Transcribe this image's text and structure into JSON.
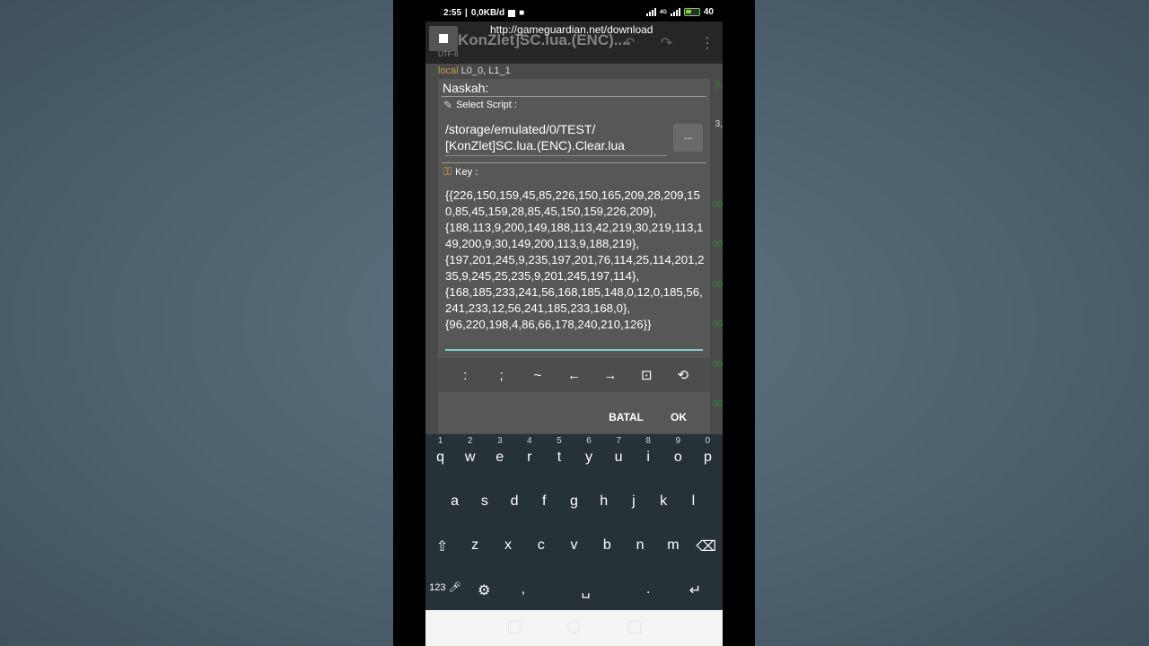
{
  "status_bar": {
    "time": "2:55",
    "net_speed": "0,0KB/d",
    "network": "4G",
    "battery": "40"
  },
  "app": {
    "url_overlay": "http://gameguardian.net/download",
    "file_title": "KonZlet]SC.lua.(ENC)....",
    "file_encoding": "UTF-8",
    "code_keyword": "local",
    "code_rest": " L0_0,  L1_1",
    "right_peek": [
      "(L",
      "3,",
      "00",
      "00",
      "00",
      "00",
      "00",
      "00"
    ]
  },
  "dialog": {
    "title": "Naskah:",
    "select_script_label": "Select Script :",
    "path_value": "/storage/emulated/0/TEST/\n[KonZlet]SC.lua.(ENC).Clear.lua",
    "browse_label": "...",
    "key_label": "Key :",
    "key_value": "{{226,150,159,45,85,226,150,165,209,28,209,150,85,45,159,28,85,45,150,159,226,209},\n{188,113,9,200,149,188,113,42,219,30,219,113,149,200,9,30,149,200,113,9,188,219},\n{197,201,245,9,235,197,201,76,114,25,114,201,235,9,245,25,235,9,201,245,197,114},\n{168,185,233,241,56,168,185,148,0,12,0,185,56,241,233,12,56,241,185,233,168,0},\n{96,220,198,4,86,66,178,240,210,126}}",
    "symbols": [
      ":",
      ";",
      "~",
      "←",
      "→",
      "⊡",
      "⟲"
    ],
    "cancel_label": "BATAL",
    "ok_label": "OK"
  },
  "keyboard": {
    "row1": [
      {
        "k": "q",
        "n": "1"
      },
      {
        "k": "w",
        "n": "2"
      },
      {
        "k": "e",
        "n": "3"
      },
      {
        "k": "r",
        "n": "4"
      },
      {
        "k": "t",
        "n": "5"
      },
      {
        "k": "y",
        "n": "6"
      },
      {
        "k": "u",
        "n": "7"
      },
      {
        "k": "i",
        "n": "8"
      },
      {
        "k": "o",
        "n": "9"
      },
      {
        "k": "p",
        "n": "0"
      }
    ],
    "row2": [
      "a",
      "s",
      "d",
      "f",
      "g",
      "h",
      "j",
      "k",
      "l"
    ],
    "row3": [
      "⇧",
      "z",
      "x",
      "c",
      "v",
      "b",
      "n",
      "m",
      "⌫"
    ],
    "row4": [
      "123",
      "⚙",
      ",",
      "␣",
      ".",
      "↵"
    ]
  }
}
